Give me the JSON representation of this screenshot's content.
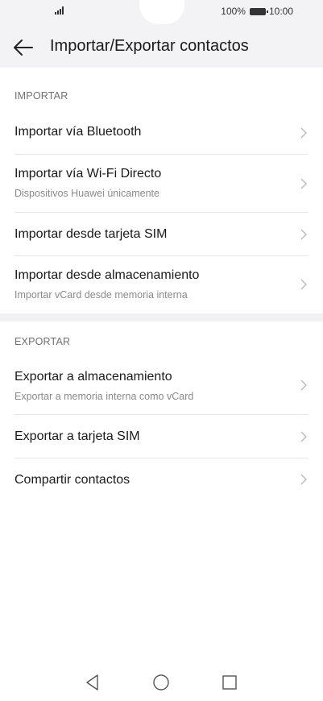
{
  "status": {
    "battery_text": "100%",
    "time": "10:00"
  },
  "header": {
    "title": "Importar/Exportar contactos"
  },
  "import_section": {
    "label": "IMPORTAR",
    "items": [
      {
        "title": "Importar vía Bluetooth",
        "subtitle": ""
      },
      {
        "title": "Importar vía Wi-Fi Directo",
        "subtitle": "Dispositivos Huawei únicamente"
      },
      {
        "title": "Importar desde tarjeta SIM",
        "subtitle": ""
      },
      {
        "title": "Importar desde almacenamiento",
        "subtitle": "Importar vCard desde memoria interna"
      }
    ]
  },
  "export_section": {
    "label": "EXPORTAR",
    "items": [
      {
        "title": "Exportar a almacenamiento",
        "subtitle": "Exportar a memoria interna como vCard"
      },
      {
        "title": "Exportar a tarjeta SIM",
        "subtitle": ""
      },
      {
        "title": "Compartir contactos",
        "subtitle": ""
      }
    ]
  },
  "icons": {
    "back": "arrow-left-icon",
    "chevron": "chevron-right-icon",
    "nav_back": "triangle-back-icon",
    "nav_home": "circle-home-icon",
    "nav_recents": "square-recents-icon"
  },
  "colors": {
    "header_bg": "#f3f3f5",
    "section_label": "#707070",
    "subtitle": "#8a8a8a",
    "chevron": "#b8b8b8"
  }
}
